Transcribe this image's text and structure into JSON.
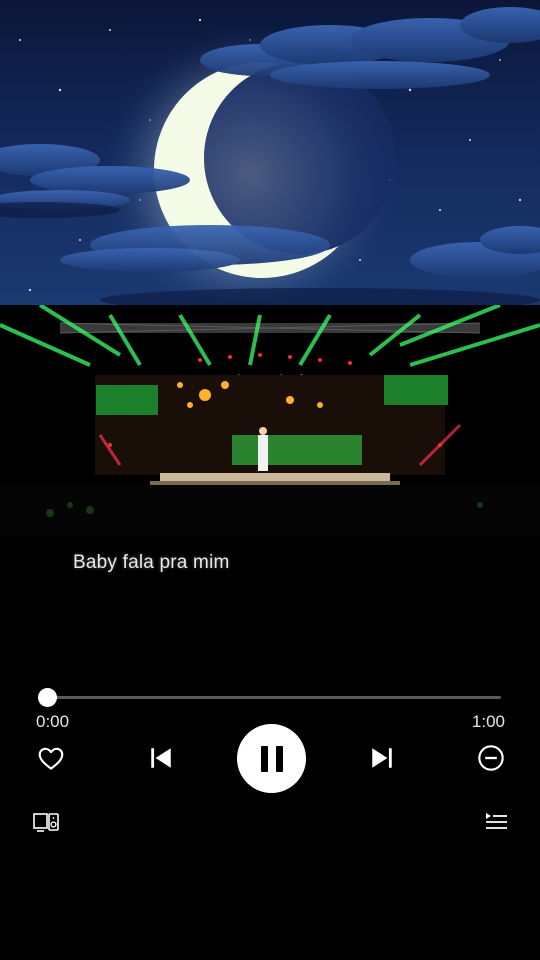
{
  "artwork": {
    "icon": "crescent-moon-night-sky"
  },
  "video": {
    "icon": "concert-stage-video-frame"
  },
  "lyrics": {
    "current_line": "Baby fala pra mim"
  },
  "player": {
    "elapsed": "0:00",
    "duration": "1:00",
    "progress_fraction": 0.0,
    "state": "playing"
  },
  "controls": {
    "like_icon": "heart-icon",
    "previous_icon": "skip-previous-icon",
    "pause_icon": "pause-icon",
    "next_icon": "skip-next-icon",
    "remove_icon": "minus-circle-icon",
    "devices_icon": "connect-device-icon",
    "queue_icon": "queue-icon"
  },
  "colors": {
    "background": "#000000",
    "accent": "#ffffff",
    "track": "#5a5a5a",
    "stage_green": "#39ff6a",
    "moon": "#f4fbe6"
  }
}
